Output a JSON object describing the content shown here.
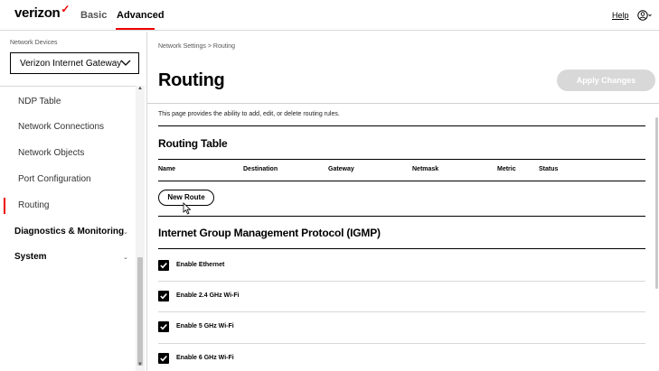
{
  "header": {
    "logo": "verizon",
    "tabs": [
      "Basic",
      "Advanced"
    ],
    "active_tab": "Advanced",
    "help_label": "Help",
    "accent_color": "#ee0000"
  },
  "sidebar": {
    "device_label": "Network Devices",
    "device_selected": "Verizon Internet Gateway",
    "items": [
      {
        "label": "NDP Table"
      },
      {
        "label": "Network Connections"
      },
      {
        "label": "Network Objects"
      },
      {
        "label": "Port Configuration"
      },
      {
        "label": "Routing",
        "active": true
      }
    ],
    "sections": [
      {
        "label": "Diagnostics & Monitoring"
      },
      {
        "label": "System"
      }
    ]
  },
  "main": {
    "breadcrumb": "Network Settings  >  Routing",
    "title": "Routing",
    "apply_label": "Apply Changes",
    "description": "This page provides the ability to add, edit, or delete routing rules.",
    "routing_table": {
      "title": "Routing Table",
      "columns": [
        "Name",
        "Destination",
        "Gateway",
        "Netmask",
        "Metric",
        "Status"
      ],
      "new_route_label": "New Route"
    },
    "igmp": {
      "title": "Internet Group Management Protocol (IGMP)",
      "options": [
        {
          "label": "Enable Ethernet",
          "checked": true
        },
        {
          "label": "Enable 2.4 GHz Wi-Fi",
          "checked": true
        },
        {
          "label": "Enable 5 GHz Wi-Fi",
          "checked": true
        },
        {
          "label": "Enable 6 GHz Wi-Fi",
          "checked": true
        }
      ]
    }
  }
}
